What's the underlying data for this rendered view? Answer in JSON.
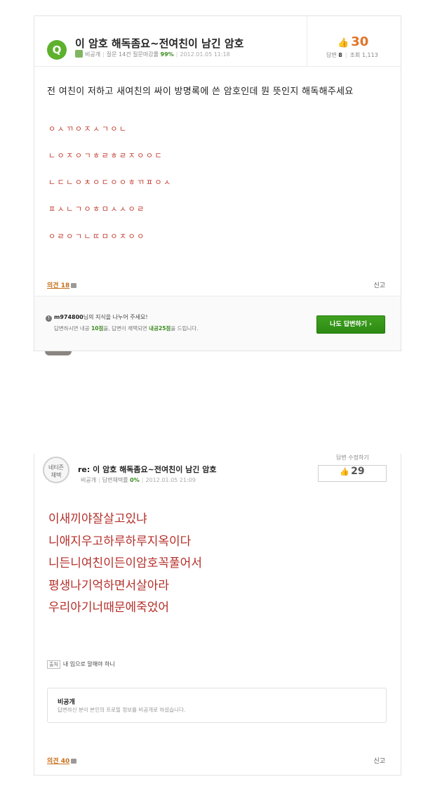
{
  "question": {
    "badge": "Q",
    "title": "이 암호 해독좀요~전여친이 남긴 암호",
    "author": "비공개",
    "stats_text": "질문 14건 질문마감률",
    "close_rate": "99%",
    "date": "2012.01.05 11:18",
    "likes": "30",
    "answers_label": "답변",
    "answers_count": "8",
    "views_label": "조회",
    "views_count": "1,113",
    "body": "전 여친이 저하고 새여친의 싸이 방명록에 쓴 암호인데 뭔 뜻인지 해독해주세요",
    "code_lines": [
      "ㅇㅅㄲㅇㅈㅅㄱㅇㄴ",
      "ㄴㅇㅈㅇㄱㅎㄹㅎㄹㅈㅇㅇㄷ",
      "ㄴㄷㄴㅇㅊㅇㄷㅇㅇㅎㄲㅍㅇㅅ",
      "ㅍㅅㄴㄱㅇㅎㅁㅅㅅㅇㄹ",
      "ㅇㄹㅇㄱㄴㄸㅁㅇㅈㅇㅇ"
    ],
    "opinion_label": "의견 18",
    "report_label": "신고",
    "share_user": "m974800",
    "share_text": "님의 지식을 나누어 주세요!",
    "points_prefix": "답변하시면 내공",
    "points_a": "10점",
    "points_mid": "을, 답변이 채택되면",
    "points_b": "내공25점",
    "points_suffix": "을 드립니다.",
    "answer_button": "나도 답변하기 ›"
  },
  "answer": {
    "badge_line1": "네티즌",
    "badge_line2": "채택",
    "title": "re: 이 암호 해독좀요~전여친이 남긴 암호",
    "author": "비공개",
    "adopt_text": "답변채택률",
    "adopt_rate": "0%",
    "date": "2012.01.05 21:09",
    "edit_label": "답변 수정하기",
    "likes": "29",
    "lines": [
      "이새끼야잘살고있냐",
      "니애지우고하루하루지옥이다",
      "니든니여친이든이암호꼭풀어서",
      "평생나기억하면서살아라",
      "우리아기너때문에죽었어"
    ],
    "source_tag": "출처",
    "source_text": "내 입으로 말해야 하니",
    "private_title": "비공개",
    "private_desc": "답변하신 분이 본인의 프로필 정보를 비공개로 하셨습니다.",
    "opinion_label": "의견 40",
    "report_label": "신고"
  },
  "colors": {
    "green_badge": "#5db12d",
    "like_orange": "#e0742a",
    "answer_red": "#b42f2a",
    "button_green": "#2d8a14"
  }
}
